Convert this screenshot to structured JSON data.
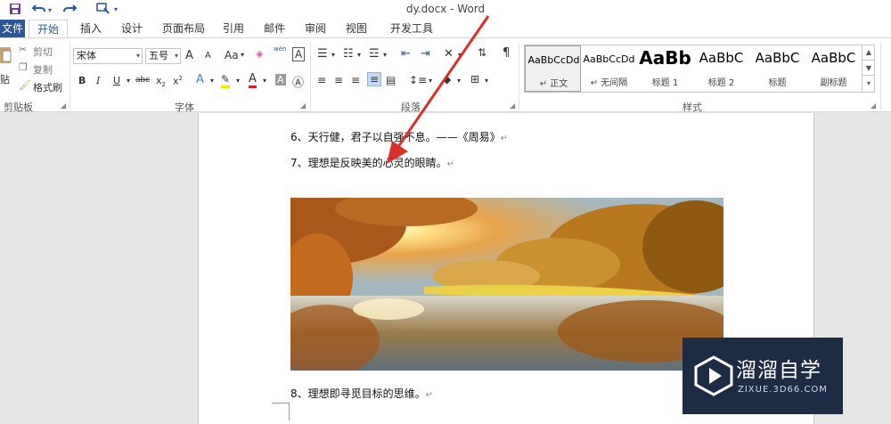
{
  "window": {
    "title": "dy.docx - Word"
  },
  "tabs": {
    "file": "文件",
    "home": "开始",
    "insert": "插入",
    "design": "设计",
    "layout": "页面布局",
    "references": "引用",
    "mailings": "邮件",
    "review": "审阅",
    "view": "视图",
    "developer": "开发工具"
  },
  "clipboard": {
    "paste": "贴",
    "cut": "剪切",
    "copy": "复制",
    "format_painter": "格式刷",
    "label": "剪贴板"
  },
  "font": {
    "name": "宋体",
    "size": "五号",
    "label": "字体",
    "aa": "Aa",
    "grow": "A",
    "shrink": "A",
    "wen": "wén",
    "a_box": "A",
    "bold": "B",
    "italic": "I",
    "underline": "U",
    "strike": "abc",
    "subscript": "x",
    "superscript": "x",
    "text_effect": "A",
    "font_color": "A",
    "shading": "A"
  },
  "paragraph": {
    "label": "段落"
  },
  "styles": {
    "label": "样式",
    "items": [
      {
        "sample": "AaBbCcDd",
        "name": "↵ 正文"
      },
      {
        "sample": "AaBbCcDd",
        "name": "↵ 无间隔"
      },
      {
        "sample": "AaBb",
        "name": "标题 1"
      },
      {
        "sample": "AaBbC",
        "name": "标题 2"
      },
      {
        "sample": "AaBbC",
        "name": "标题"
      },
      {
        "sample": "AaBbC",
        "name": "副标题"
      }
    ]
  },
  "document": {
    "line6": "6、天行健，君子以自强不息。——《周易》",
    "line7": "7、理想是反映美的心灵的眼睛。",
    "line8": "8、理想即寻觅目标的思维。",
    "para_mark": "↵"
  },
  "watermark": {
    "brand": "溜溜自学",
    "url": "ZIXUE.3D66.COM"
  },
  "colors": {
    "accent": "#2b579a",
    "arrow": "#d9302c",
    "watermark_bg": "#1e2b45"
  }
}
